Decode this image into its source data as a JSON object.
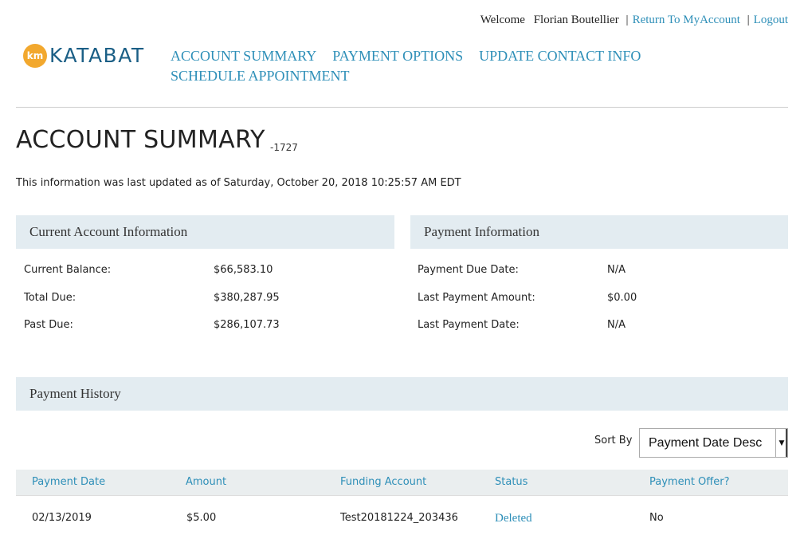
{
  "header": {
    "welcome": "Welcome",
    "user_name": "Florian Boutellier",
    "separator": "|",
    "return_link": "Return To MyAccount",
    "logout_link": "Logout"
  },
  "logo": {
    "mark": "km",
    "text": "KATABAT",
    "mark_color": "#f2a82e",
    "text_color": "#1b5f86"
  },
  "nav": {
    "items": [
      "ACCOUNT SUMMARY",
      "PAYMENT OPTIONS",
      "UPDATE CONTACT INFO",
      "SCHEDULE APPOINTMENT"
    ]
  },
  "page": {
    "title": "ACCOUNT SUMMARY",
    "account_suffix": "-1727",
    "updated_text": "This information was last updated as of Saturday, October 20, 2018 10:25:57 AM EDT"
  },
  "current_account": {
    "heading": "Current Account Information",
    "rows": [
      {
        "label": "Current Balance:",
        "value": "$66,583.10"
      },
      {
        "label": "Total Due:",
        "value": "$380,287.95"
      },
      {
        "label": "Past Due:",
        "value": "$286,107.73"
      }
    ]
  },
  "payment_info": {
    "heading": "Payment Information",
    "rows": [
      {
        "label": "Payment Due Date:",
        "value": "N/A"
      },
      {
        "label": "Last Payment Amount:",
        "value": "$0.00"
      },
      {
        "label": "Last Payment Date:",
        "value": "N/A"
      }
    ]
  },
  "payment_history": {
    "heading": "Payment History",
    "sort_label": "Sort By",
    "sort_value": "Payment Date Desc",
    "columns": [
      "Payment Date",
      "Amount",
      "Funding Account",
      "Status",
      "Payment Offer?"
    ],
    "rows": [
      {
        "date": "02/13/2019",
        "amount": "$5.00",
        "funding": "Test20181224_203436",
        "status": "Deleted",
        "offer": "No"
      }
    ]
  },
  "colors": {
    "link": "#2e8fb8",
    "panel_bg": "#e3ecf1",
    "table_head_bg": "#eaeeef"
  }
}
